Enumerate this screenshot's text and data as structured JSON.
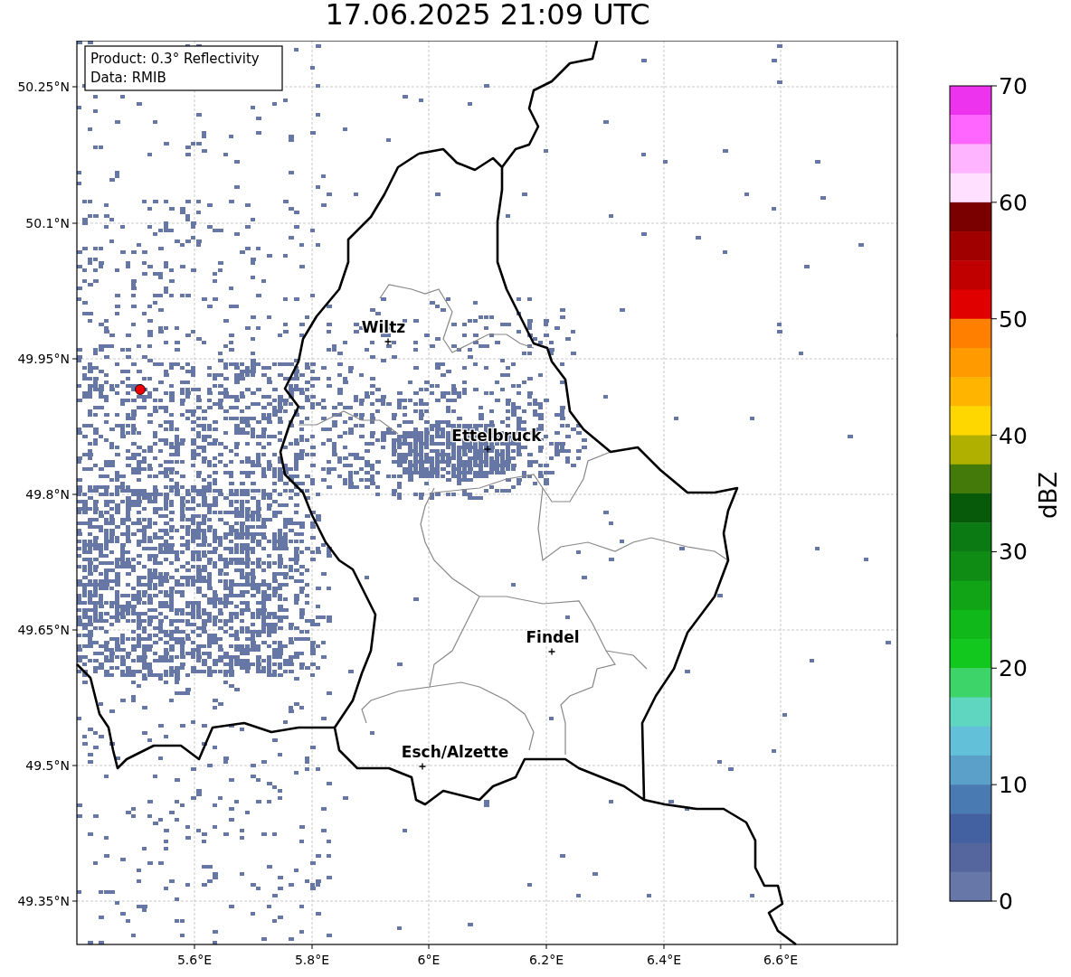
{
  "title": "17.06.2025 21:09 UTC",
  "info_box": {
    "lines": [
      "Product: 0.3° Reflectivity",
      "Data: RMIB"
    ]
  },
  "map": {
    "x_ticks": [
      "5.6°E",
      "5.8°E",
      "6°E",
      "6.2°E",
      "6.4°E",
      "6.6°E"
    ],
    "y_ticks": [
      "50.25°N",
      "50.1°N",
      "49.95°N",
      "49.8°N",
      "49.65°N",
      "49.5°N",
      "49.35°N"
    ],
    "cities": [
      {
        "name": "Wiltz"
      },
      {
        "name": "Ettelbruck"
      },
      {
        "name": "Findel"
      },
      {
        "name": "Esch/Alzette"
      }
    ]
  },
  "colorbar": {
    "label": "dBZ",
    "ticks": [
      "70",
      "60",
      "50",
      "40",
      "30",
      "20",
      "10",
      "0"
    ],
    "bins": [
      {
        "color": "#ee33ee"
      },
      {
        "color": "#ff66ff"
      },
      {
        "color": "#ffb4ff"
      },
      {
        "color": "#ffe0ff"
      },
      {
        "color": "#7a0000"
      },
      {
        "color": "#a00000"
      },
      {
        "color": "#c00000"
      },
      {
        "color": "#e00000"
      },
      {
        "color": "#ff7f00"
      },
      {
        "color": "#ff9a00"
      },
      {
        "color": "#ffb400"
      },
      {
        "color": "#ffd700"
      },
      {
        "color": "#b0b000"
      },
      {
        "color": "#447a0a"
      },
      {
        "color": "#065a0a"
      },
      {
        "color": "#0b7a12"
      },
      {
        "color": "#0e8c14"
      },
      {
        "color": "#10a416"
      },
      {
        "color": "#10b81a"
      },
      {
        "color": "#12c81e"
      },
      {
        "color": "#3dd46a"
      },
      {
        "color": "#5ed6c0"
      },
      {
        "color": "#62c0d8"
      },
      {
        "color": "#5aa0c8"
      },
      {
        "color": "#4a7ab2"
      },
      {
        "color": "#4360a0"
      },
      {
        "color": "#55669f"
      },
      {
        "color": "#6677a8"
      }
    ]
  }
}
